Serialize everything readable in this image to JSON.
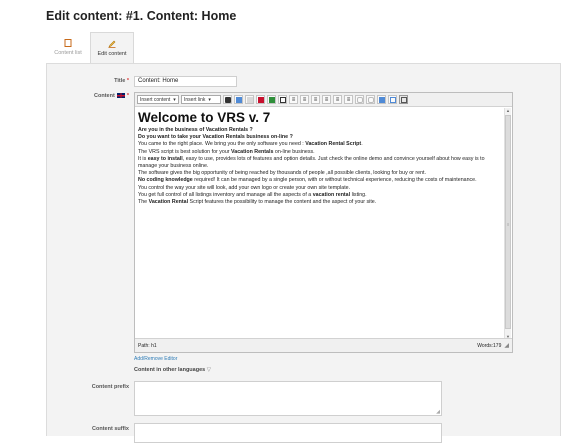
{
  "page": {
    "title": "Edit content: #1. Content: Home"
  },
  "tabs": [
    {
      "label": "Content list",
      "icon": "document-icon"
    },
    {
      "label": "Edit content",
      "icon": "pencil-icon"
    }
  ],
  "form": {
    "title_label": "Title",
    "title_value": "Content: Home",
    "content_label": "Content",
    "required_mark": "*",
    "prefix_label": "Content prefix",
    "suffix_label": "Content suffix",
    "add_remove_editor": "Add/Remove Editor",
    "other_languages": "Content in other languages",
    "other_languages_arrow": "▽"
  },
  "editor": {
    "insert_content": "Insert content",
    "insert_link": "Insert link",
    "status_path": "Path: h1",
    "word_count": "Words:179",
    "heading": "Welcome to VRS v. 7",
    "lines": {
      "l1": "Are you in the business of Vacation Rentals ?",
      "l2": "Do you want to take your Vacation Rentals business on-line ?",
      "l3a": "You came to the right place. We bring you the only software you need : ",
      "l3b": "Vacation Rental Script",
      "l3c": ".",
      "l4a": "The VRS script is best solution for your ",
      "l4b": "Vacation Rentals",
      "l4c": " on-line business.",
      "l5a": "It is ",
      "l5b": "easy to install",
      "l5c": ", easy to use, provides lots of features and option details. Just check the online demo and convince yourself about how easy is to manage your business online.",
      "l6": "The software gives the big opportunity of being reached by thousands of people ,all possible clients, looking for buy or rent.",
      "l7a": "No coding knowledge",
      "l7b": " required! It can be managed by a single person, with or without technical experience, reducing the costs of maintenance.",
      "l8": "You control the way your site will look, add your own logo or create your own site template.",
      "l9a": "You get full control of all listings inventory and manage all the aspects of a ",
      "l9b": "vacation rental",
      "l9c": " listing.",
      "l10a": "The ",
      "l10b": "Vacation Rental",
      "l10c": " Script features the possibility to manage the content and the aspect of your site."
    }
  },
  "colors": {
    "panel": "#f3f3f3",
    "link": "#2c7bb6",
    "required": "#dd3333"
  }
}
